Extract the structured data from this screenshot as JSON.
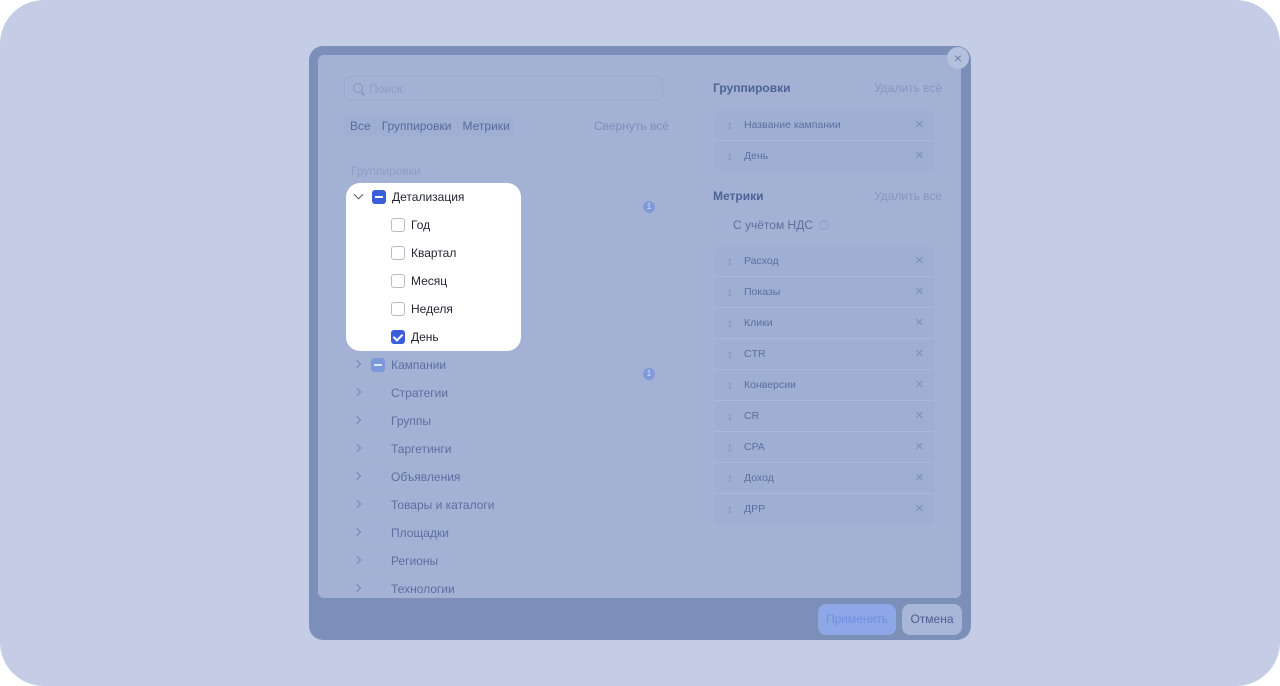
{
  "dialog": {
    "search_placeholder": "Поиск",
    "close_glyph": "×",
    "collapse_all": "Свернуть всё",
    "tabs": [
      "Все",
      "Группировки",
      "Метрики"
    ],
    "left_section_label": "Группировки",
    "tree_other": [
      {
        "label": "Кампании",
        "state": "mixed",
        "count": "1"
      },
      {
        "label": "Стратегии",
        "state": "empty"
      },
      {
        "label": "Группы",
        "state": "empty"
      },
      {
        "label": "Таргетинги",
        "state": "empty"
      },
      {
        "label": "Объявления",
        "state": "empty"
      },
      {
        "label": "Товары и каталоги",
        "state": "empty"
      },
      {
        "label": "Площадки",
        "state": "empty"
      },
      {
        "label": "Регионы",
        "state": "empty"
      },
      {
        "label": "Технологии",
        "state": "empty"
      }
    ],
    "detail": {
      "label": "Детализация",
      "count": "1",
      "children": [
        {
          "label": "Год",
          "checked": false
        },
        {
          "label": "Квартал",
          "checked": false
        },
        {
          "label": "Месяц",
          "checked": false
        },
        {
          "label": "Неделя",
          "checked": false
        },
        {
          "label": "День",
          "checked": true
        }
      ]
    },
    "groupings": {
      "title": "Группировки",
      "delete_all": "Удалить всё",
      "items": [
        "Название кампании",
        "День"
      ]
    },
    "metrics": {
      "title": "Метрики",
      "delete_all": "Удалить всё",
      "vat_label": "С учётом НДС",
      "help_glyph": "?",
      "items": [
        "Расход",
        "Показы",
        "Клики",
        "CTR",
        "Конверсии",
        "CR",
        "CPA",
        "Доход",
        "ДРР"
      ]
    },
    "icons": {
      "grip": "↕",
      "remove": "✕"
    },
    "apply_label": "Применить",
    "cancel_label": "Отмена"
  }
}
